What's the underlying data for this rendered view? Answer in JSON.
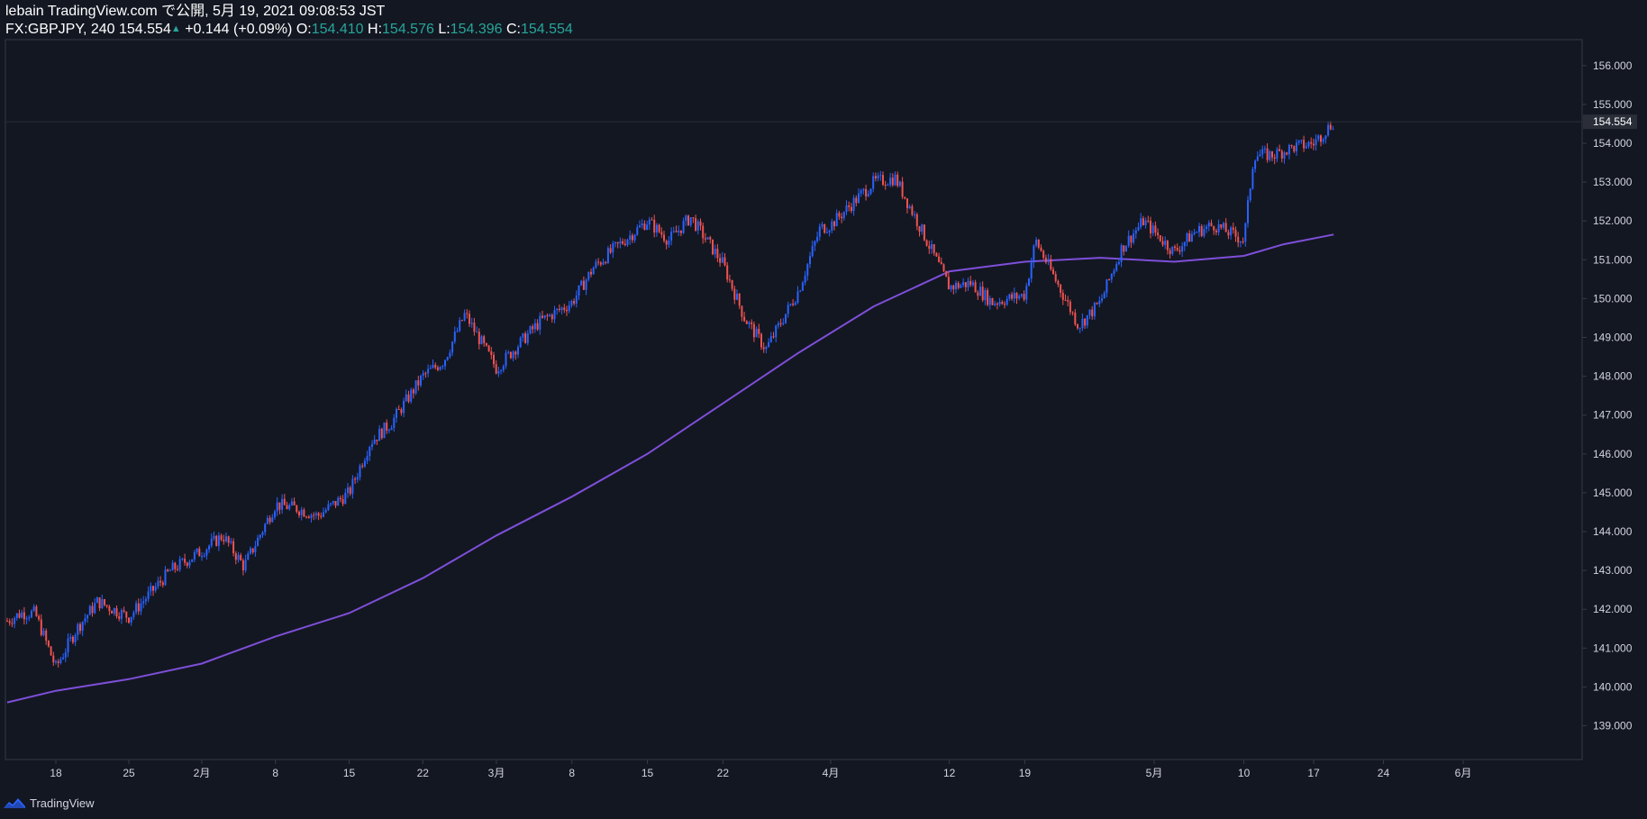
{
  "header": {
    "publish_line": "lebain TradingView.com で公開, 5月 19, 2021 09:08:53 JST",
    "symbol": "FX:GBPJPY, 240",
    "last": "154.554",
    "change": "+0.144 (+0.09%)",
    "o_label": "O:",
    "o_value": "154.410",
    "h_label": "H:",
    "h_value": "154.576",
    "l_label": "L:",
    "l_value": "154.396",
    "c_label": "C:",
    "c_value": "154.554"
  },
  "footer": {
    "brand": "TradingView",
    "logo_icon": "tradingview-logo-icon"
  },
  "colors": {
    "background": "#131722",
    "up": "#2962ff",
    "down": "#ef5350",
    "ma": "#7e4fd9",
    "axis_text": "#d1d4dc",
    "border": "#363a45"
  },
  "chart_data": {
    "type": "line",
    "symbol": "FX:GBPJPY",
    "interval": "240",
    "x_tick_labels": [
      "18",
      "25",
      "2月",
      "8",
      "15",
      "22",
      "3月",
      "8",
      "15",
      "22",
      "4月",
      "12",
      "19",
      "5月",
      "10",
      "17",
      "24",
      "6月"
    ],
    "x_tick_dates": [
      "2021-01-18",
      "2021-01-25",
      "2021-02-01",
      "2021-02-08",
      "2021-02-15",
      "2021-02-22",
      "2021-03-01",
      "2021-03-08",
      "2021-03-15",
      "2021-03-22",
      "2021-04-01",
      "2021-04-12",
      "2021-04-19",
      "2021-05-01",
      "2021-05-10",
      "2021-05-17",
      "2021-05-24",
      "2021-06-01"
    ],
    "y_tick_labels": [
      "139.000",
      "140.000",
      "141.000",
      "142.000",
      "143.000",
      "144.000",
      "145.000",
      "146.000",
      "147.000",
      "148.000",
      "149.000",
      "150.000",
      "151.000",
      "152.000",
      "153.000",
      "154.000",
      "155.000",
      "156.000"
    ],
    "ylim": [
      138.2,
      156.6
    ],
    "last_price_label": "154.554",
    "series": [
      {
        "kind": "price",
        "x": [
          "2021-01-11",
          "2021-01-13",
          "2021-01-15",
          "2021-01-18",
          "2021-01-20",
          "2021-01-22",
          "2021-01-25",
          "2021-01-27",
          "2021-01-29",
          "2021-02-01",
          "2021-02-03",
          "2021-02-05",
          "2021-02-08",
          "2021-02-10",
          "2021-02-12",
          "2021-02-15",
          "2021-02-17",
          "2021-02-19",
          "2021-02-22",
          "2021-02-24",
          "2021-02-26",
          "2021-03-01",
          "2021-03-03",
          "2021-03-05",
          "2021-03-08",
          "2021-03-10",
          "2021-03-12",
          "2021-03-15",
          "2021-03-17",
          "2021-03-19",
          "2021-03-22",
          "2021-03-24",
          "2021-03-26",
          "2021-03-29",
          "2021-03-31",
          "2021-04-01",
          "2021-04-05",
          "2021-04-07",
          "2021-04-09",
          "2021-04-12",
          "2021-04-14",
          "2021-04-16",
          "2021-04-19",
          "2021-04-20",
          "2021-04-22",
          "2021-04-24",
          "2021-04-26",
          "2021-04-28",
          "2021-04-30",
          "2021-05-03",
          "2021-05-05",
          "2021-05-07",
          "2021-05-10",
          "2021-05-11",
          "2021-05-13",
          "2021-05-15",
          "2021-05-17",
          "2021-05-19"
        ],
        "y": [
          141.7,
          141.9,
          141.9,
          140.5,
          141.5,
          142.2,
          141.8,
          142.4,
          143.0,
          143.5,
          143.9,
          143.1,
          144.7,
          144.6,
          144.4,
          145.0,
          146.3,
          146.8,
          148.0,
          148.4,
          149.6,
          148.2,
          148.8,
          149.4,
          149.9,
          150.8,
          151.3,
          152.0,
          151.5,
          152.1,
          150.9,
          149.5,
          148.7,
          150.2,
          151.8,
          151.9,
          153.0,
          153.1,
          152.0,
          150.3,
          150.4,
          149.9,
          150.1,
          151.5,
          150.4,
          149.3,
          149.9,
          151.3,
          152.0,
          151.2,
          151.7,
          151.9,
          151.5,
          153.7,
          153.7,
          153.9,
          154.0,
          154.55
        ]
      },
      {
        "kind": "moving_average",
        "x": [
          "2021-01-11",
          "2021-01-18",
          "2021-01-25",
          "2021-02-01",
          "2021-02-08",
          "2021-02-15",
          "2021-02-22",
          "2021-03-01",
          "2021-03-08",
          "2021-03-15",
          "2021-03-22",
          "2021-03-29",
          "2021-04-05",
          "2021-04-12",
          "2021-04-19",
          "2021-04-26",
          "2021-05-03",
          "2021-05-10",
          "2021-05-14",
          "2021-05-19"
        ],
        "y": [
          139.6,
          139.9,
          140.2,
          140.6,
          141.3,
          141.9,
          142.8,
          143.9,
          144.9,
          146.0,
          147.3,
          148.6,
          149.8,
          150.7,
          150.95,
          151.05,
          150.95,
          151.1,
          151.4,
          151.65
        ]
      }
    ]
  }
}
